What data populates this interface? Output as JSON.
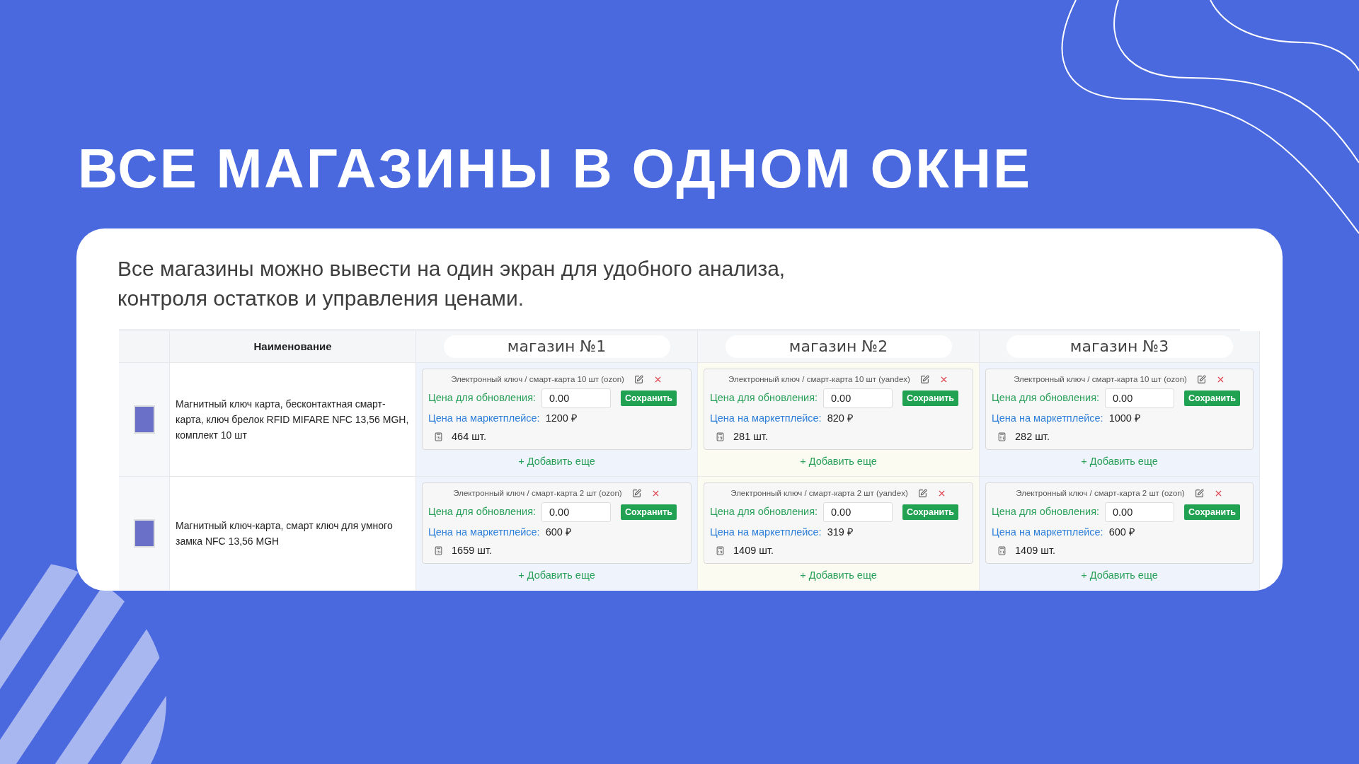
{
  "title": "ВСЕ МАГАЗИНЫ В ОДНОМ ОКНЕ",
  "description": "Все магазины можно вывести на один экран для удобного анализа, контроля остатков и управления ценами.",
  "table": {
    "name_column": "Наименование",
    "stores": [
      "магазин №1",
      "магазин №2",
      "магазин №3"
    ],
    "rows": [
      {
        "name": "Магнитный ключ карта, бесконтактная смарт-карта, ключ брелок RFID MIFARE NFC 13,56 MGH, комплект 10 шт",
        "offers": [
          {
            "title": "Электронный ключ / смарт-карта 10 шт (ozon)",
            "update_label": "Цена для обновления:",
            "update_value": "0.00",
            "save": "Сохранить",
            "market_label": "Цена на маркетплейсе:",
            "market_price": "1200 ₽",
            "stock": "464 шт.",
            "add": "+ Добавить еще"
          },
          {
            "title": "Электронный ключ / смарт-карта 10 шт (yandex)",
            "update_label": "Цена для обновления:",
            "update_value": "0.00",
            "save": "Сохранить",
            "market_label": "Цена на маркетплейсе:",
            "market_price": "820 ₽",
            "stock": "281 шт.",
            "add": "+ Добавить еще"
          },
          {
            "title": "Электронный ключ / смарт-карта 10 шт (ozon)",
            "update_label": "Цена для обновления:",
            "update_value": "0.00",
            "save": "Сохранить",
            "market_label": "Цена на маркетплейсе:",
            "market_price": "1000 ₽",
            "stock": "282 шт.",
            "add": "+ Добавить еще"
          }
        ]
      },
      {
        "name": "Магнитный ключ-карта, смарт ключ для умного замка NFC 13,56 MGH",
        "offers": [
          {
            "title": "Электронный ключ / смарт-карта 2 шт (ozon)",
            "update_label": "Цена для обновления:",
            "update_value": "0.00",
            "save": "Сохранить",
            "market_label": "Цена на маркетплейсе:",
            "market_price": "600 ₽",
            "stock": "1659 шт.",
            "add": "+ Добавить еще"
          },
          {
            "title": "Электронный ключ / смарт-карта 2 шт (yandex)",
            "update_label": "Цена для обновления:",
            "update_value": "0.00",
            "save": "Сохранить",
            "market_label": "Цена на маркетплейсе:",
            "market_price": "319 ₽",
            "stock": "1409 шт.",
            "add": "+ Добавить еще"
          },
          {
            "title": "Электронный ключ / смарт-карта 2 шт (ozon)",
            "update_label": "Цена для обновления:",
            "update_value": "0.00",
            "save": "Сохранить",
            "market_label": "Цена на маркетплейсе:",
            "market_price": "600 ₽",
            "stock": "1409 шт.",
            "add": "+ Добавить еще"
          }
        ]
      }
    ]
  }
}
